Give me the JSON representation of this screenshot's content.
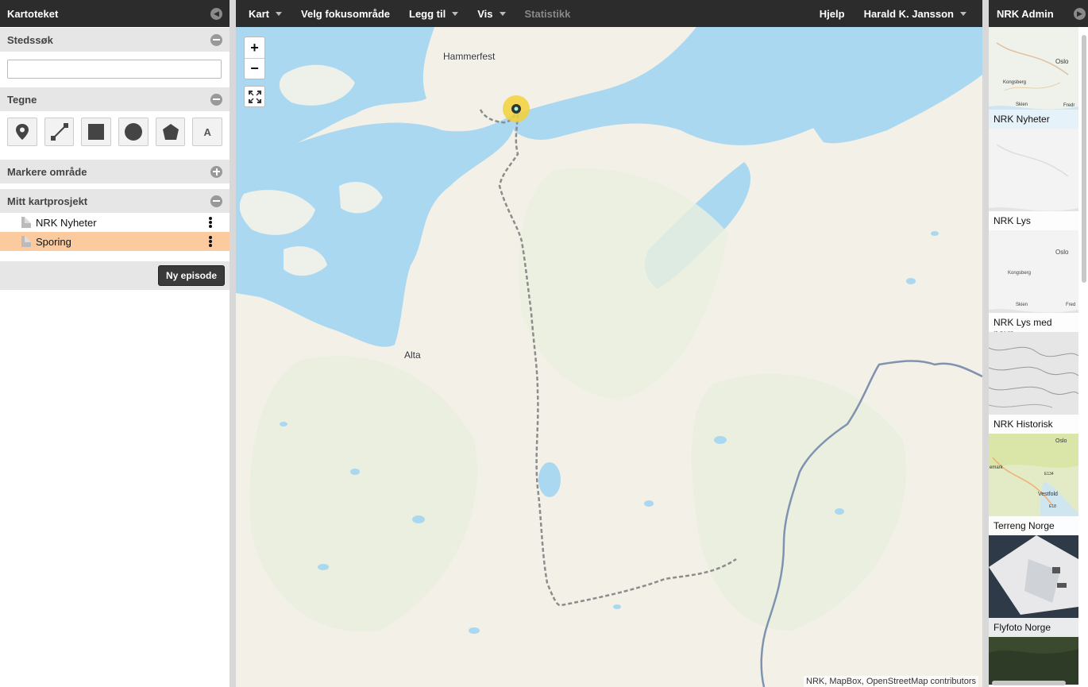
{
  "left_panel": {
    "title": "Kartoteket",
    "sections": {
      "place_search": "Stedssøk",
      "draw": "Tegne",
      "mark_area": "Markere område",
      "my_project": "Mitt kartprosjekt"
    },
    "search_value": "",
    "draw_tools": [
      "marker",
      "line",
      "rectangle",
      "circle",
      "polygon",
      "text"
    ],
    "text_tool_label": "A",
    "project_items": [
      {
        "label": "NRK Nyheter",
        "selected": false
      },
      {
        "label": "Sporing",
        "selected": true
      }
    ],
    "new_episode_label": "Ny episode"
  },
  "topbar": {
    "menus": [
      {
        "label": "Kart",
        "dropdown": true
      },
      {
        "label": "Velg fokusområde",
        "dropdown": false
      },
      {
        "label": "Legg til",
        "dropdown": true
      },
      {
        "label": "Vis",
        "dropdown": true
      },
      {
        "label": "Statistikk",
        "dropdown": false,
        "disabled": true
      }
    ],
    "help": "Hjelp",
    "user": "Harald K. Jansson"
  },
  "map": {
    "zoom_in": "+",
    "zoom_out": "−",
    "places": {
      "hammerfest": "Hammerfest",
      "alta": "Alta"
    },
    "attribution": "NRK, MapBox, OpenStreetMap contributors",
    "colors": {
      "water": "#aad8f0",
      "land": "#f2efe6",
      "route": "#8c8c8c",
      "border": "#7f93b0",
      "marker": "#f2d13a"
    }
  },
  "right_panel": {
    "title": "NRK Admin",
    "basemaps": [
      "NRK Nyheter",
      "NRK Lys",
      "NRK Lys med navn",
      "NRK Historisk",
      "Terreng Norge",
      "Flyfoto Norge"
    ],
    "thumb_labels": {
      "oslo": "Oslo",
      "kongsberg": "Kongsberg",
      "skien": "Skien",
      "fredrikstad_partial": "Fredr",
      "fredrikstad_partial_2": "Fred",
      "vestfold": "Vestfold",
      "telemark_partial": "emark",
      "road_e134": "E134",
      "road_e18": "E18"
    }
  }
}
